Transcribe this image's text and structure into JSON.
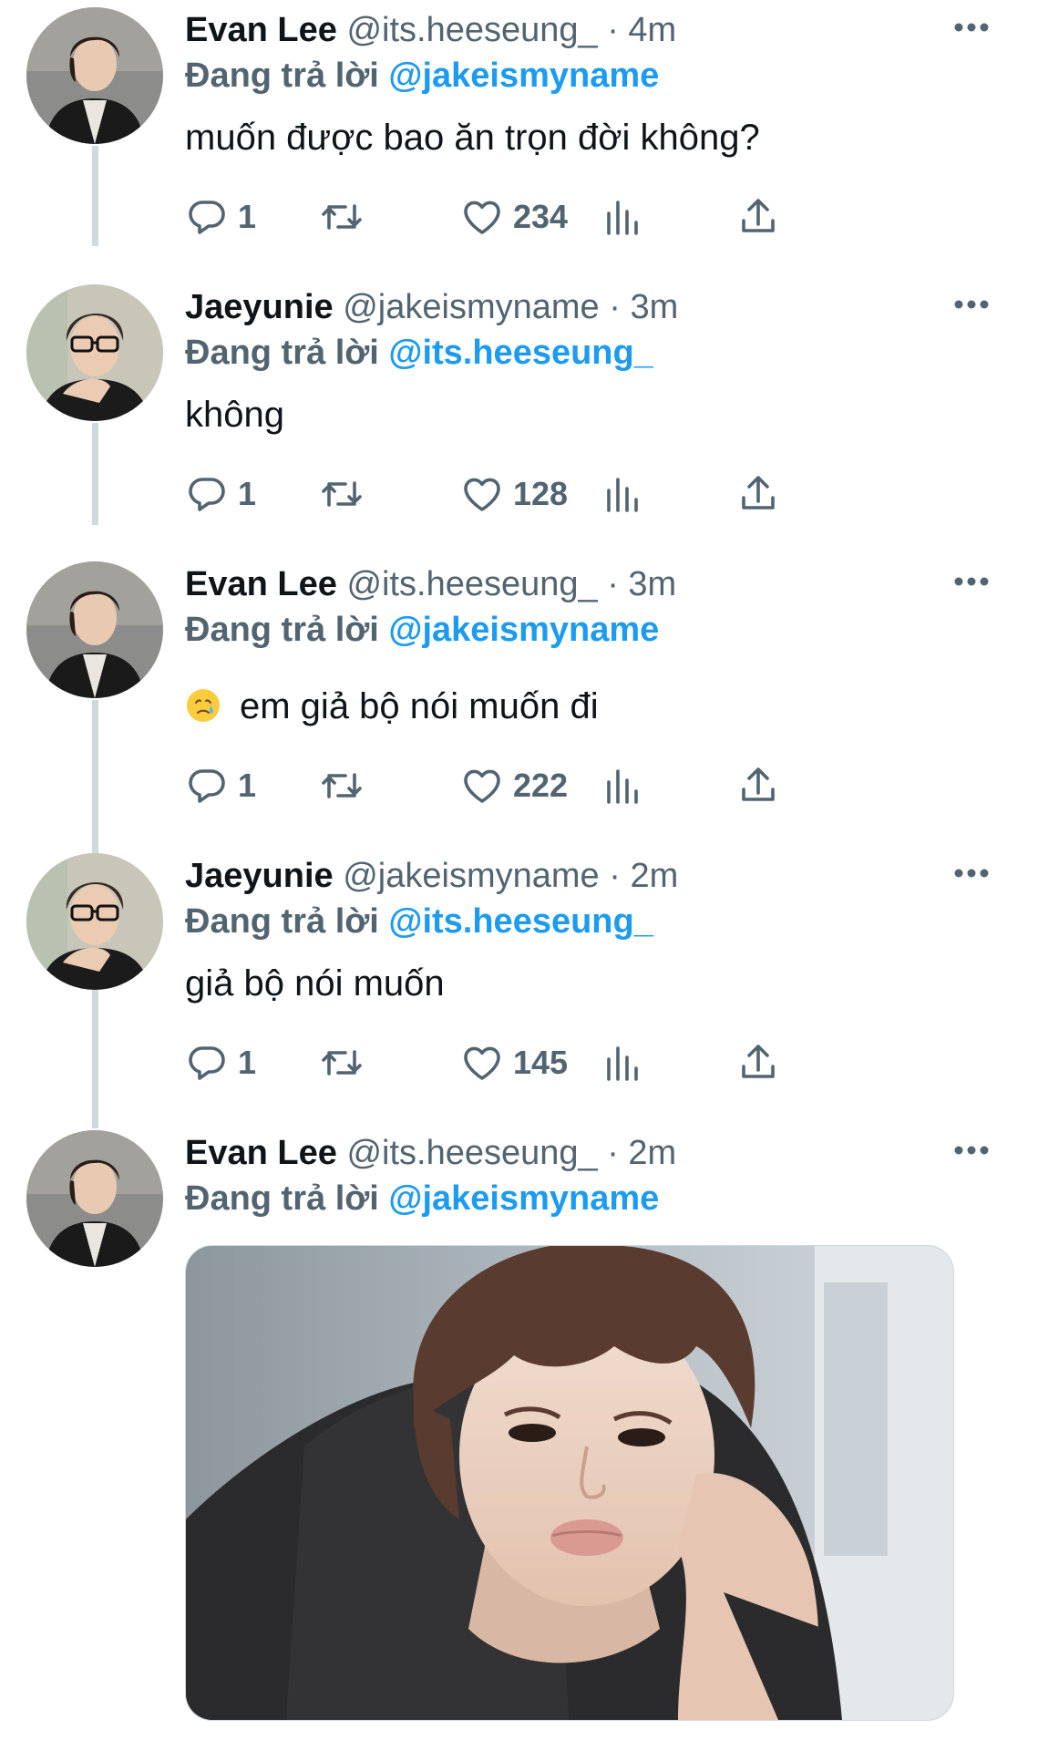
{
  "tweets": [
    {
      "name": "Evan Lee",
      "handle": "@its.heeseung_",
      "separator": "·",
      "time": "4m",
      "replying_prefix": "Đang trả lời",
      "replying_to": "@jakeismyname",
      "text": "muốn được bao ăn trọn đời không?",
      "replies": "1",
      "likes": "234"
    },
    {
      "name": "Jaeyunie",
      "handle": "@jakeismyname",
      "separator": "·",
      "time": "3m",
      "replying_prefix": "Đang trả lời",
      "replying_to": "@its.heeseung_",
      "text": "không",
      "replies": "1",
      "likes": "128"
    },
    {
      "name": "Evan Lee",
      "handle": "@its.heeseung_",
      "separator": "·",
      "time": "3m",
      "replying_prefix": "Đang trả lời",
      "replying_to": "@jakeismyname",
      "text_emoji": "crying-face",
      "text": "em giả bộ nói muốn đi",
      "replies": "1",
      "likes": "222"
    },
    {
      "name": "Jaeyunie",
      "handle": "@jakeismyname",
      "separator": "·",
      "time": "2m",
      "replying_prefix": "Đang trả lời",
      "replying_to": "@its.heeseung_",
      "text": "giả bộ nói muốn",
      "replies": "1",
      "likes": "145"
    },
    {
      "name": "Evan Lee",
      "handle": "@its.heeseung_",
      "separator": "·",
      "time": "2m",
      "replying_prefix": "Đang trả lời",
      "replying_to": "@jakeismyname",
      "media": "photo-pouting-person"
    }
  ],
  "icons": {
    "reply": "reply-icon",
    "retweet": "retweet-icon",
    "like": "heart-icon",
    "views": "analytics-icon",
    "share": "share-icon",
    "more": "more-icon"
  },
  "colors": {
    "accent": "#1d9bf0",
    "secondary_text": "#536471",
    "primary_text": "#0f1419",
    "thread_line": "#cfd9de"
  }
}
